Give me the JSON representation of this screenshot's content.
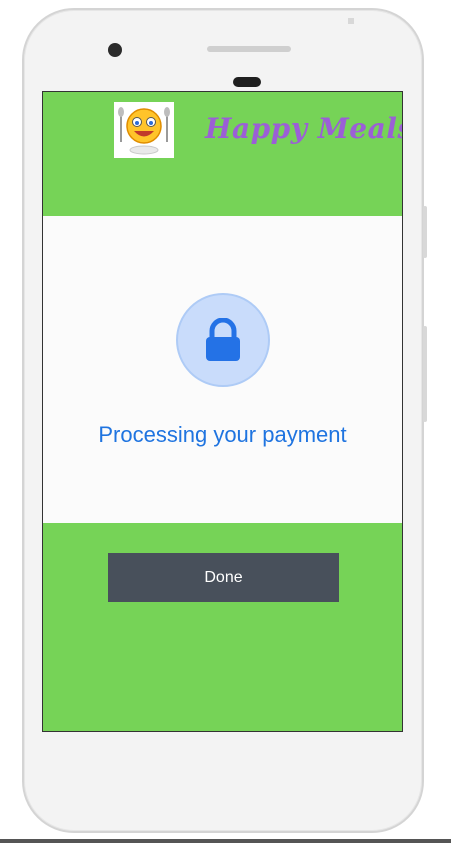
{
  "header": {
    "brand_title": "Happy Meals",
    "logo_icon": "smiley-chef-logo-icon"
  },
  "payment": {
    "icon": "lock-icon",
    "status_text": "Processing your payment"
  },
  "actions": {
    "done_label": "Done"
  },
  "colors": {
    "screen_background": "#76d357",
    "brand_text": "#9b5fd6",
    "status_text": "#1f74e0",
    "button_background": "#48505b"
  }
}
